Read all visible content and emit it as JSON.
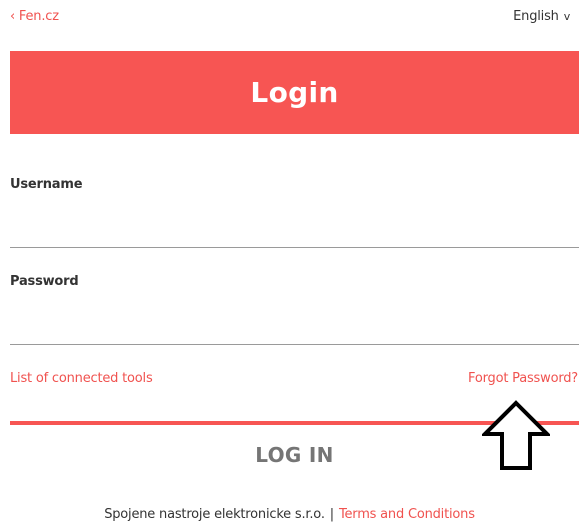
{
  "header": {
    "back_link": "‹ Fen.cz",
    "language": "English",
    "language_chevron": "v"
  },
  "banner": {
    "title": "Login"
  },
  "form": {
    "username_label": "Username",
    "username_value": "",
    "password_label": "Password",
    "password_value": ""
  },
  "links": {
    "connected_tools": "List of connected tools",
    "forgot_password": "Forgot Password?"
  },
  "login_button": "LOG IN",
  "footer": {
    "company": "Spojene nastroje elektronicke s.r.o.",
    "separator": "|",
    "terms": "Terms and Conditions"
  },
  "colors": {
    "accent": "#f75553",
    "link": "#f0524f",
    "button_text": "#757575"
  },
  "icons": {
    "overlay_arrow": "up-arrow-icon"
  }
}
